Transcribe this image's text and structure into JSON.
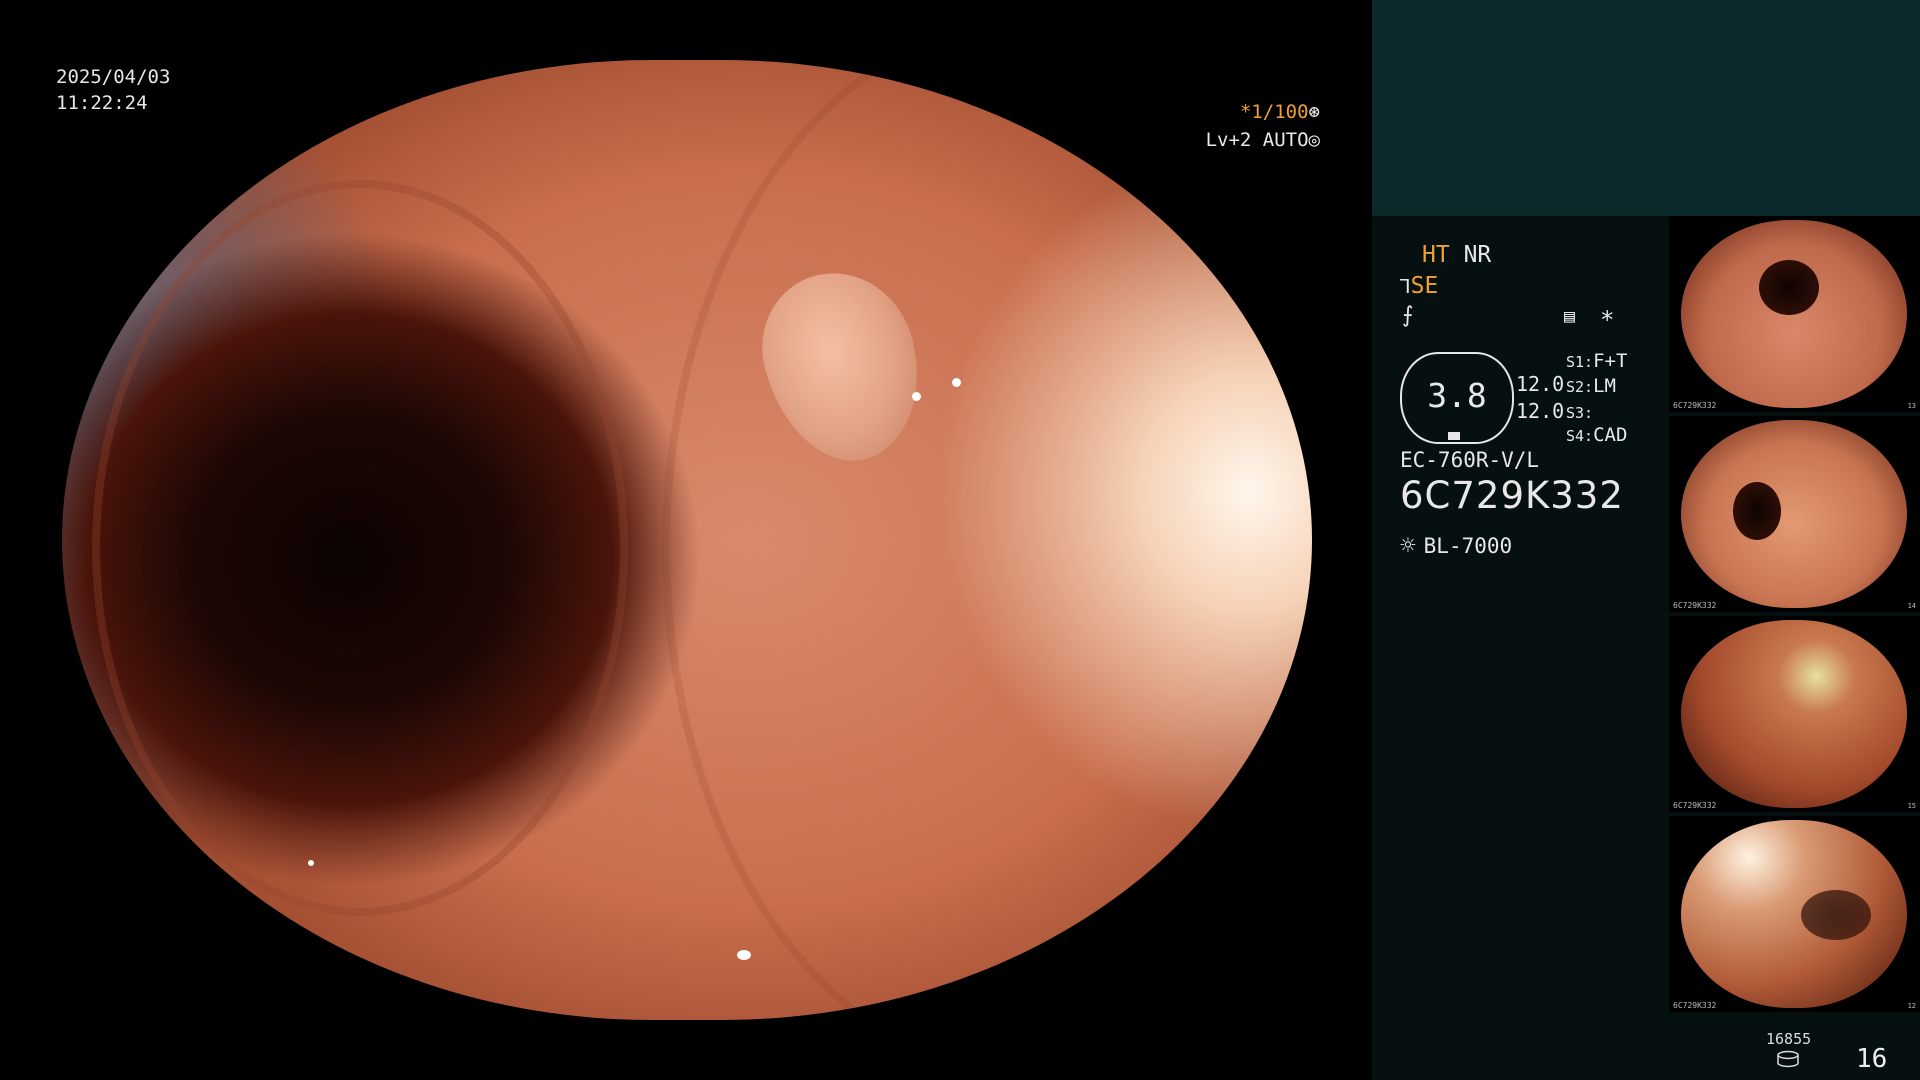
{
  "overlay": {
    "date": "2025/04/03",
    "time": "11:22:24",
    "shutter": "*1/100",
    "shutter_icon": "aperture-icon",
    "level": "Lv+2",
    "mode": "AUTO",
    "mode_icon": "iris-icon"
  },
  "settings": {
    "ht_label": "HT",
    "nr_label": "NR",
    "se_label": "SE",
    "gauge_value": "3.8",
    "val1": "12.0",
    "val2": "12.0",
    "s1_label": "S1:",
    "s1_value": "F+T",
    "s2_label": "S2:",
    "s2_value": "LM",
    "s3_label": "S3:",
    "s3_value": "",
    "s4_label": "S4:",
    "s4_value": "CAD",
    "asterisk": "*"
  },
  "scope": {
    "model": "EC-760R-V/L",
    "serial": "6C729K332",
    "light_source": "BL-7000"
  },
  "thumbnails": [
    {
      "caption": "6C729K332",
      "index_label": "13"
    },
    {
      "caption": "6C729K332",
      "index_label": "14"
    },
    {
      "caption": "6C729K332",
      "index_label": "15"
    },
    {
      "caption": "6C729K332",
      "index_label": "12"
    }
  ],
  "footer": {
    "storage_count": "16855",
    "image_count": "16"
  },
  "colors": {
    "accent": "#f0a030",
    "panel_bg": "#061010",
    "panel_header": "#0c2a2c"
  }
}
